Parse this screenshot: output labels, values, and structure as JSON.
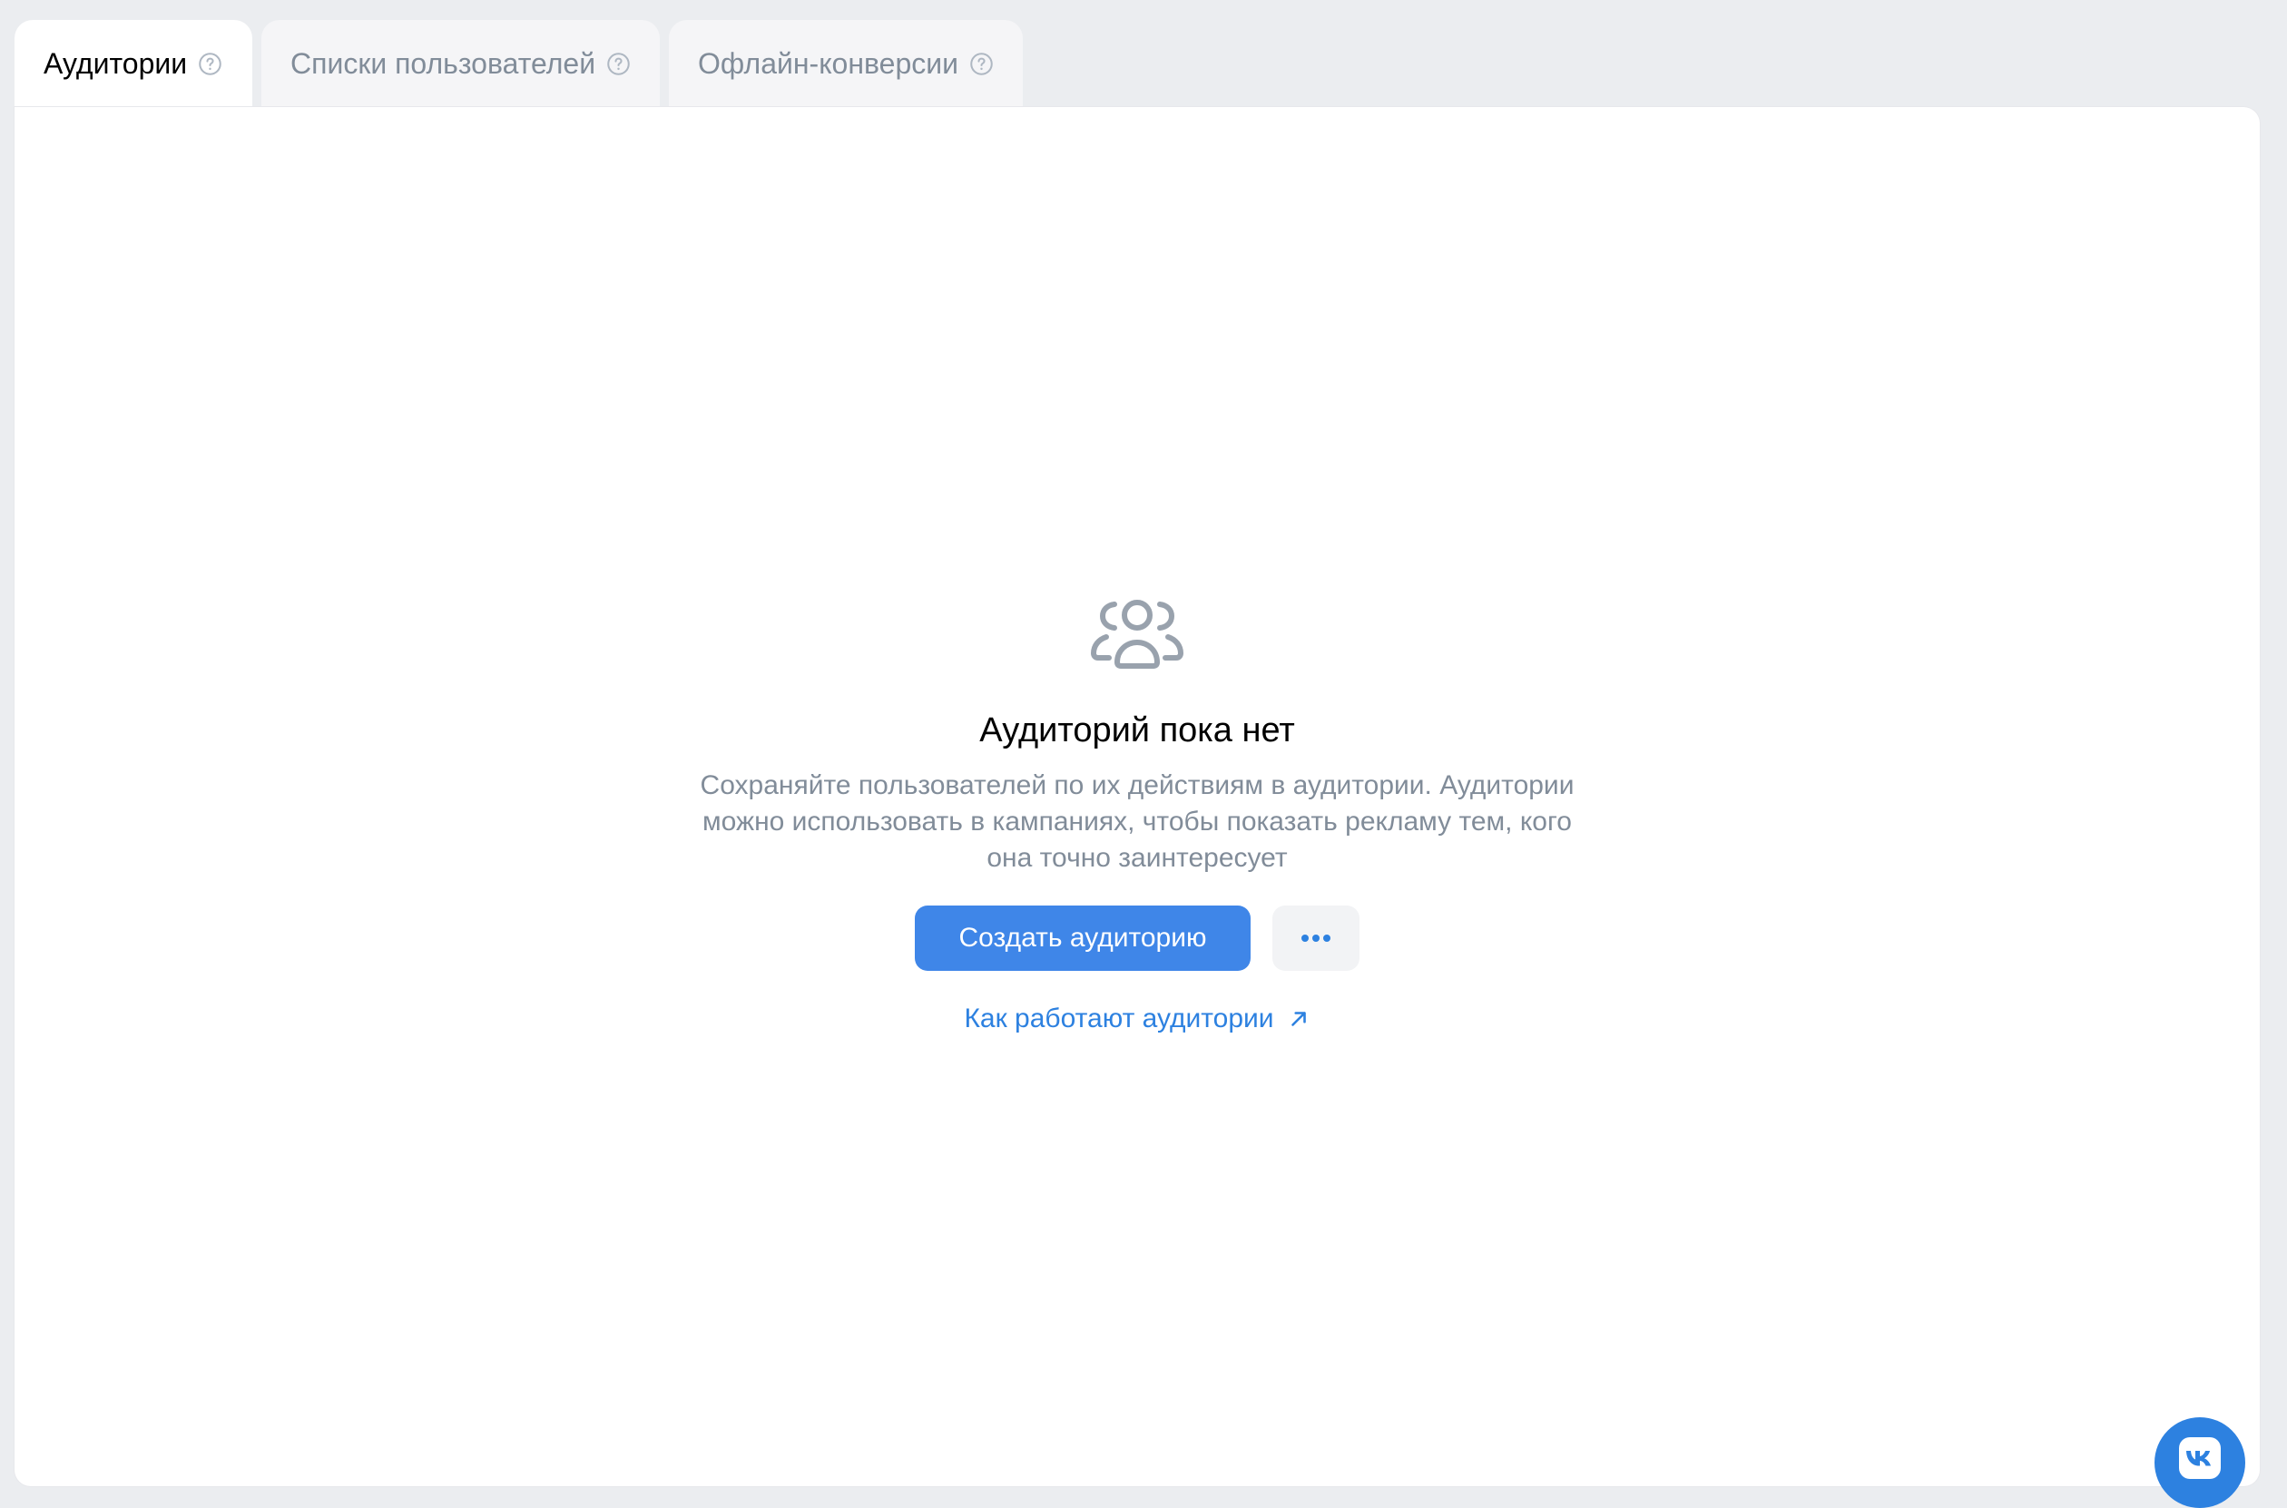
{
  "tabs": [
    {
      "label": "Аудитории",
      "active": true
    },
    {
      "label": "Списки пользователей",
      "active": false
    },
    {
      "label": "Офлайн-конверсии",
      "active": false
    }
  ],
  "empty_state": {
    "icon": "users-group-icon",
    "title": "Аудиторий пока нет",
    "description": "Сохраняйте пользователей по их действиям в аудитории. Аудитории можно использовать в кампаниях, чтобы показать рекламу тем, кого она точно заинтересует",
    "create_button": "Создать аудиторию",
    "more_button": "more-dots-icon",
    "help_link": "Как работают аудитории"
  },
  "fab": {
    "icon": "vk-logo-icon"
  },
  "colors": {
    "accent": "#3f86e8",
    "link": "#2d81e0",
    "muted_text": "#818c99",
    "background": "#ebedf0"
  }
}
